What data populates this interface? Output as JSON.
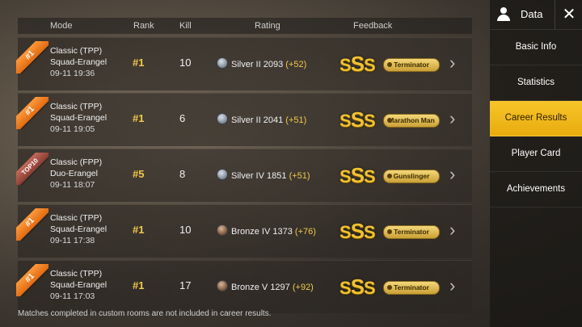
{
  "header": {
    "mode": "Mode",
    "rank": "Rank",
    "kill": "Kill",
    "rating": "Rating",
    "feedback": "Feedback"
  },
  "rows": [
    {
      "ribbon": "#1",
      "mode": "Classic (TPP)",
      "map": "Squad-Erangel",
      "time": "09-11 19:36",
      "rank": "#1",
      "kill": "10",
      "tier": "Silver II",
      "tier_icon": "silver-rank-icon",
      "score": "2093",
      "delta": "(+52)",
      "grade": "SSS",
      "title": "Terminator"
    },
    {
      "ribbon": "#1",
      "mode": "Classic (TPP)",
      "map": "Squad-Erangel",
      "time": "09-11 19:05",
      "rank": "#1",
      "kill": "6",
      "tier": "Silver II",
      "tier_icon": "silver-rank-icon",
      "score": "2041",
      "delta": "(+51)",
      "grade": "SSS",
      "title": "Marathon Man"
    },
    {
      "ribbon": "TOP10",
      "mode": "Classic (FPP)",
      "map": "Duo-Erangel",
      "time": "09-11 18:07",
      "rank": "#5",
      "kill": "8",
      "tier": "Silver IV",
      "tier_icon": "silver-rank-icon",
      "score": "1851",
      "delta": "(+51)",
      "grade": "SSS",
      "title": "Gunslinger"
    },
    {
      "ribbon": "#1",
      "mode": "Classic (TPP)",
      "map": "Squad-Erangel",
      "time": "09-11 17:38",
      "rank": "#1",
      "kill": "10",
      "tier": "Bronze IV",
      "tier_icon": "bronze-rank-icon",
      "score": "1373",
      "delta": "(+76)",
      "grade": "SSS",
      "title": "Terminator"
    },
    {
      "ribbon": "#1",
      "mode": "Classic (TPP)",
      "map": "Squad-Erangel",
      "time": "09-11 17:03",
      "rank": "#1",
      "kill": "17",
      "tier": "Bronze V",
      "tier_icon": "bronze-rank-icon",
      "score": "1297",
      "delta": "(+92)",
      "grade": "SSS",
      "title": "Terminator"
    }
  ],
  "footnote": "Matches completed in custom rooms are not included in career results.",
  "sidebar": {
    "title": "Data",
    "close": "✕",
    "items": [
      "Basic Info",
      "Statistics",
      "Career Results",
      "Player Card",
      "Achievements"
    ],
    "active_index": 2
  },
  "colors": {
    "accent": "#f2c230",
    "rank_yellow": "#f2c94c",
    "ribbon_orange": "#e06a12"
  }
}
